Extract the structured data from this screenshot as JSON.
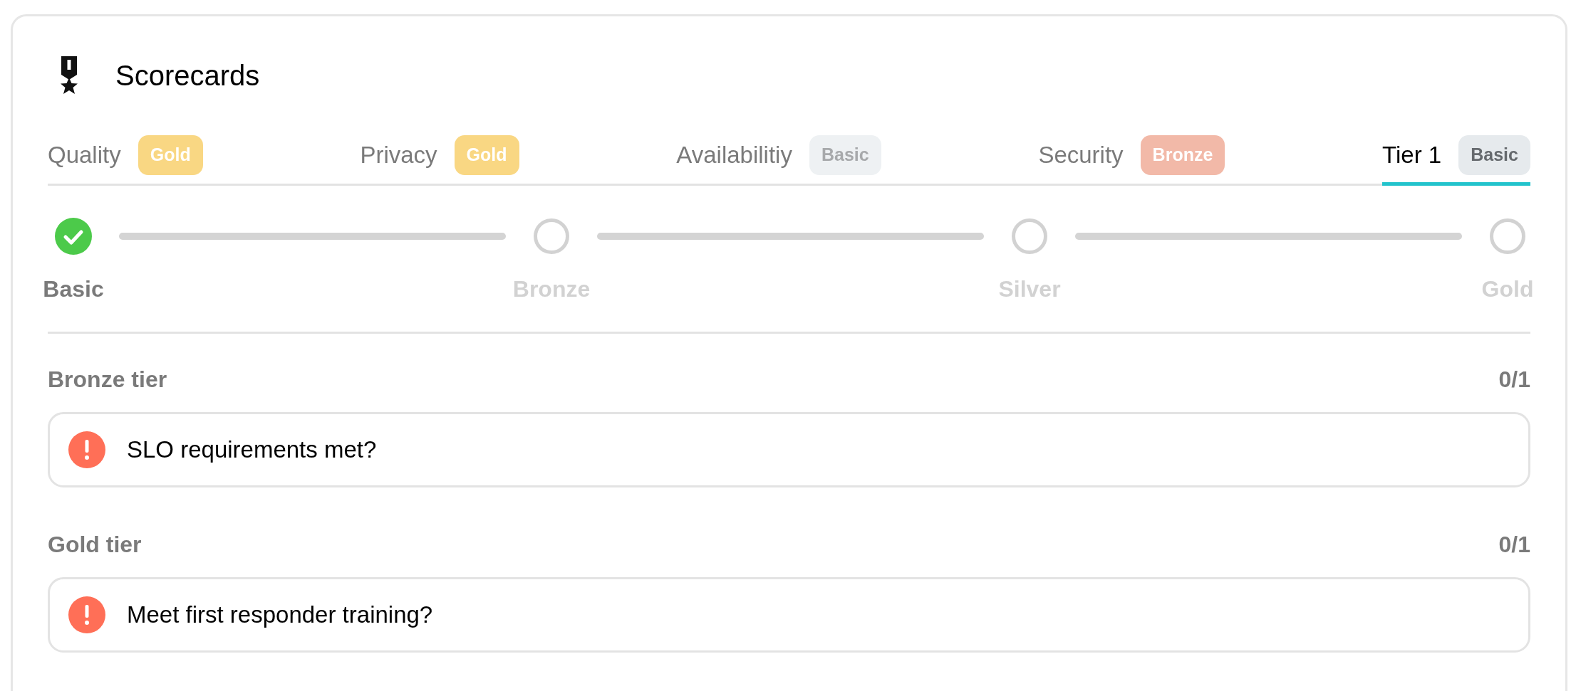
{
  "card": {
    "title": "Scorecards"
  },
  "tabs": [
    {
      "label": "Quality",
      "badge": {
        "text": "Gold",
        "kind": "gold"
      },
      "selected": false
    },
    {
      "label": "Privacy",
      "badge": {
        "text": "Gold",
        "kind": "gold"
      },
      "selected": false
    },
    {
      "label": "Availabilitiy",
      "badge": {
        "text": "Basic",
        "kind": "basic"
      },
      "selected": false
    },
    {
      "label": "Security",
      "badge": {
        "text": "Bronze",
        "kind": "bronze"
      },
      "selected": false
    },
    {
      "label": "Tier 1",
      "badge": {
        "text": "Basic",
        "kind": "basic"
      },
      "selected": true
    }
  ],
  "steps": [
    {
      "label": "Basic",
      "done": true
    },
    {
      "label": "Bronze",
      "done": false
    },
    {
      "label": "Silver",
      "done": false
    },
    {
      "label": "Gold",
      "done": false
    }
  ],
  "sections": [
    {
      "title": "Bronze tier",
      "count": "0/1",
      "rules": [
        {
          "text": "SLO requirements met?",
          "passed": false
        }
      ]
    },
    {
      "title": "Gold tier",
      "count": "0/1",
      "rules": [
        {
          "text": "Meet first responder training?",
          "passed": false
        }
      ]
    }
  ]
}
